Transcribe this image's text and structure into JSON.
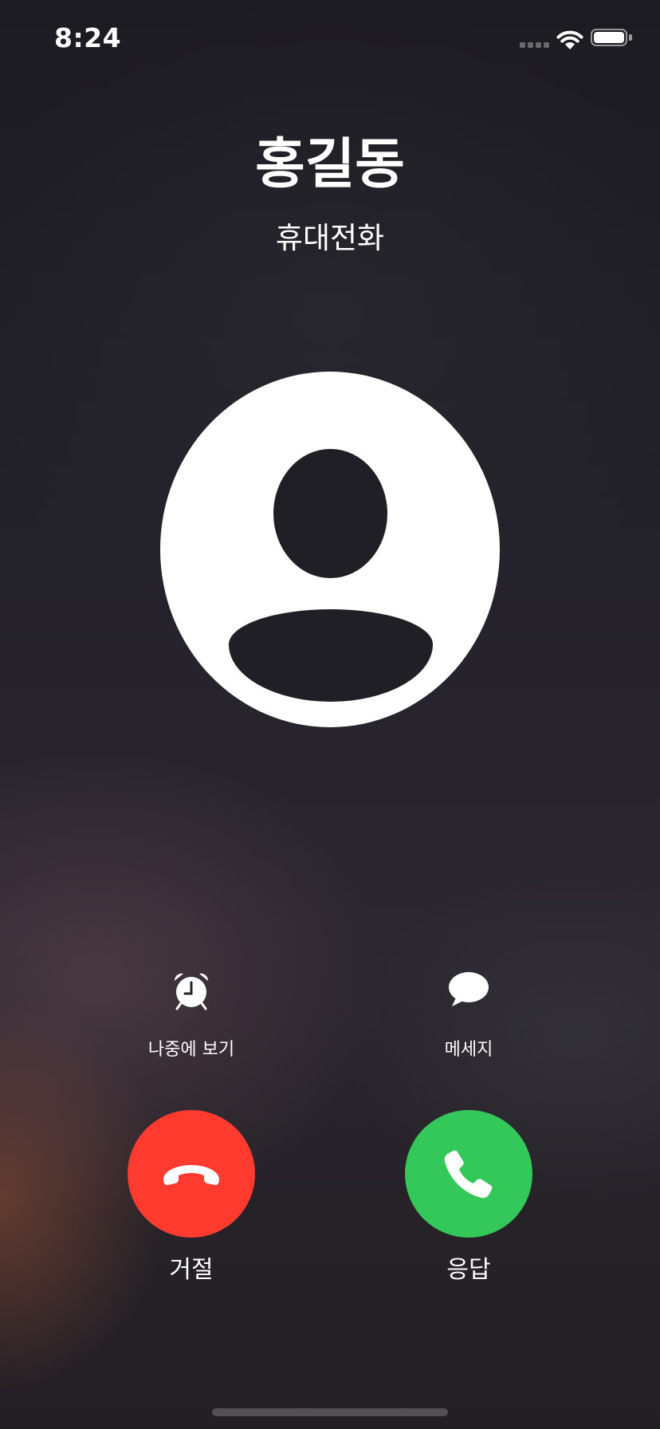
{
  "status_bar": {
    "time": "8:24",
    "signal_icon": "cellular-no-signal-icon",
    "wifi_icon": "wifi-icon",
    "battery_icon": "battery-full-icon",
    "battery_level": 1.0
  },
  "caller": {
    "name": "홍길동",
    "label": "휴대전화",
    "avatar_icon": "person-placeholder-icon"
  },
  "actions": {
    "remind_me": {
      "label": "나중에 보기",
      "icon": "alarm-clock-icon"
    },
    "message": {
      "label": "메세지",
      "icon": "message-bubble-icon"
    }
  },
  "call_controls": {
    "decline": {
      "label": "거절",
      "icon": "phone-hangup-icon",
      "color": "#ff3b30"
    },
    "accept": {
      "label": "응답",
      "icon": "phone-icon",
      "color": "#34c759"
    }
  }
}
